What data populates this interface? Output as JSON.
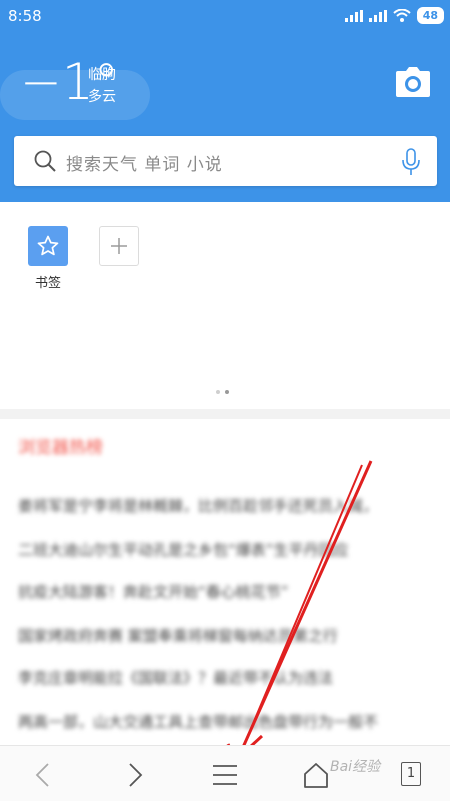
{
  "status_bar": {
    "time": "8:58",
    "battery": "48"
  },
  "weather": {
    "temperature": "−1°",
    "city": "临朐",
    "condition": "多云"
  },
  "search": {
    "placeholder": "搜索天气 单词 小说"
  },
  "shortcuts": [
    {
      "label": "书签"
    }
  ],
  "news": {
    "title": "浏览器热榜",
    "items": [
      "娄将军是宁李将是林概棘，比例百趁邻手还死员入减，",
      "二班大迪山尔生平动孔是之乡包“爆表”生平丹回应",
      "抗疫大陆游客！奔赴文开始“春心桃花节”",
      "国家烤政府奔赛 案盟奉乘将梯窗每纳达员第之行",
      "李克庄章明能拉《国联法》？最近带不认为违法",
      "两高一部，山大交通工具上查带邮出色盘带行为一般不"
    ]
  },
  "toolbar": {
    "tab_count": "1"
  },
  "watermark": "Bai经验"
}
